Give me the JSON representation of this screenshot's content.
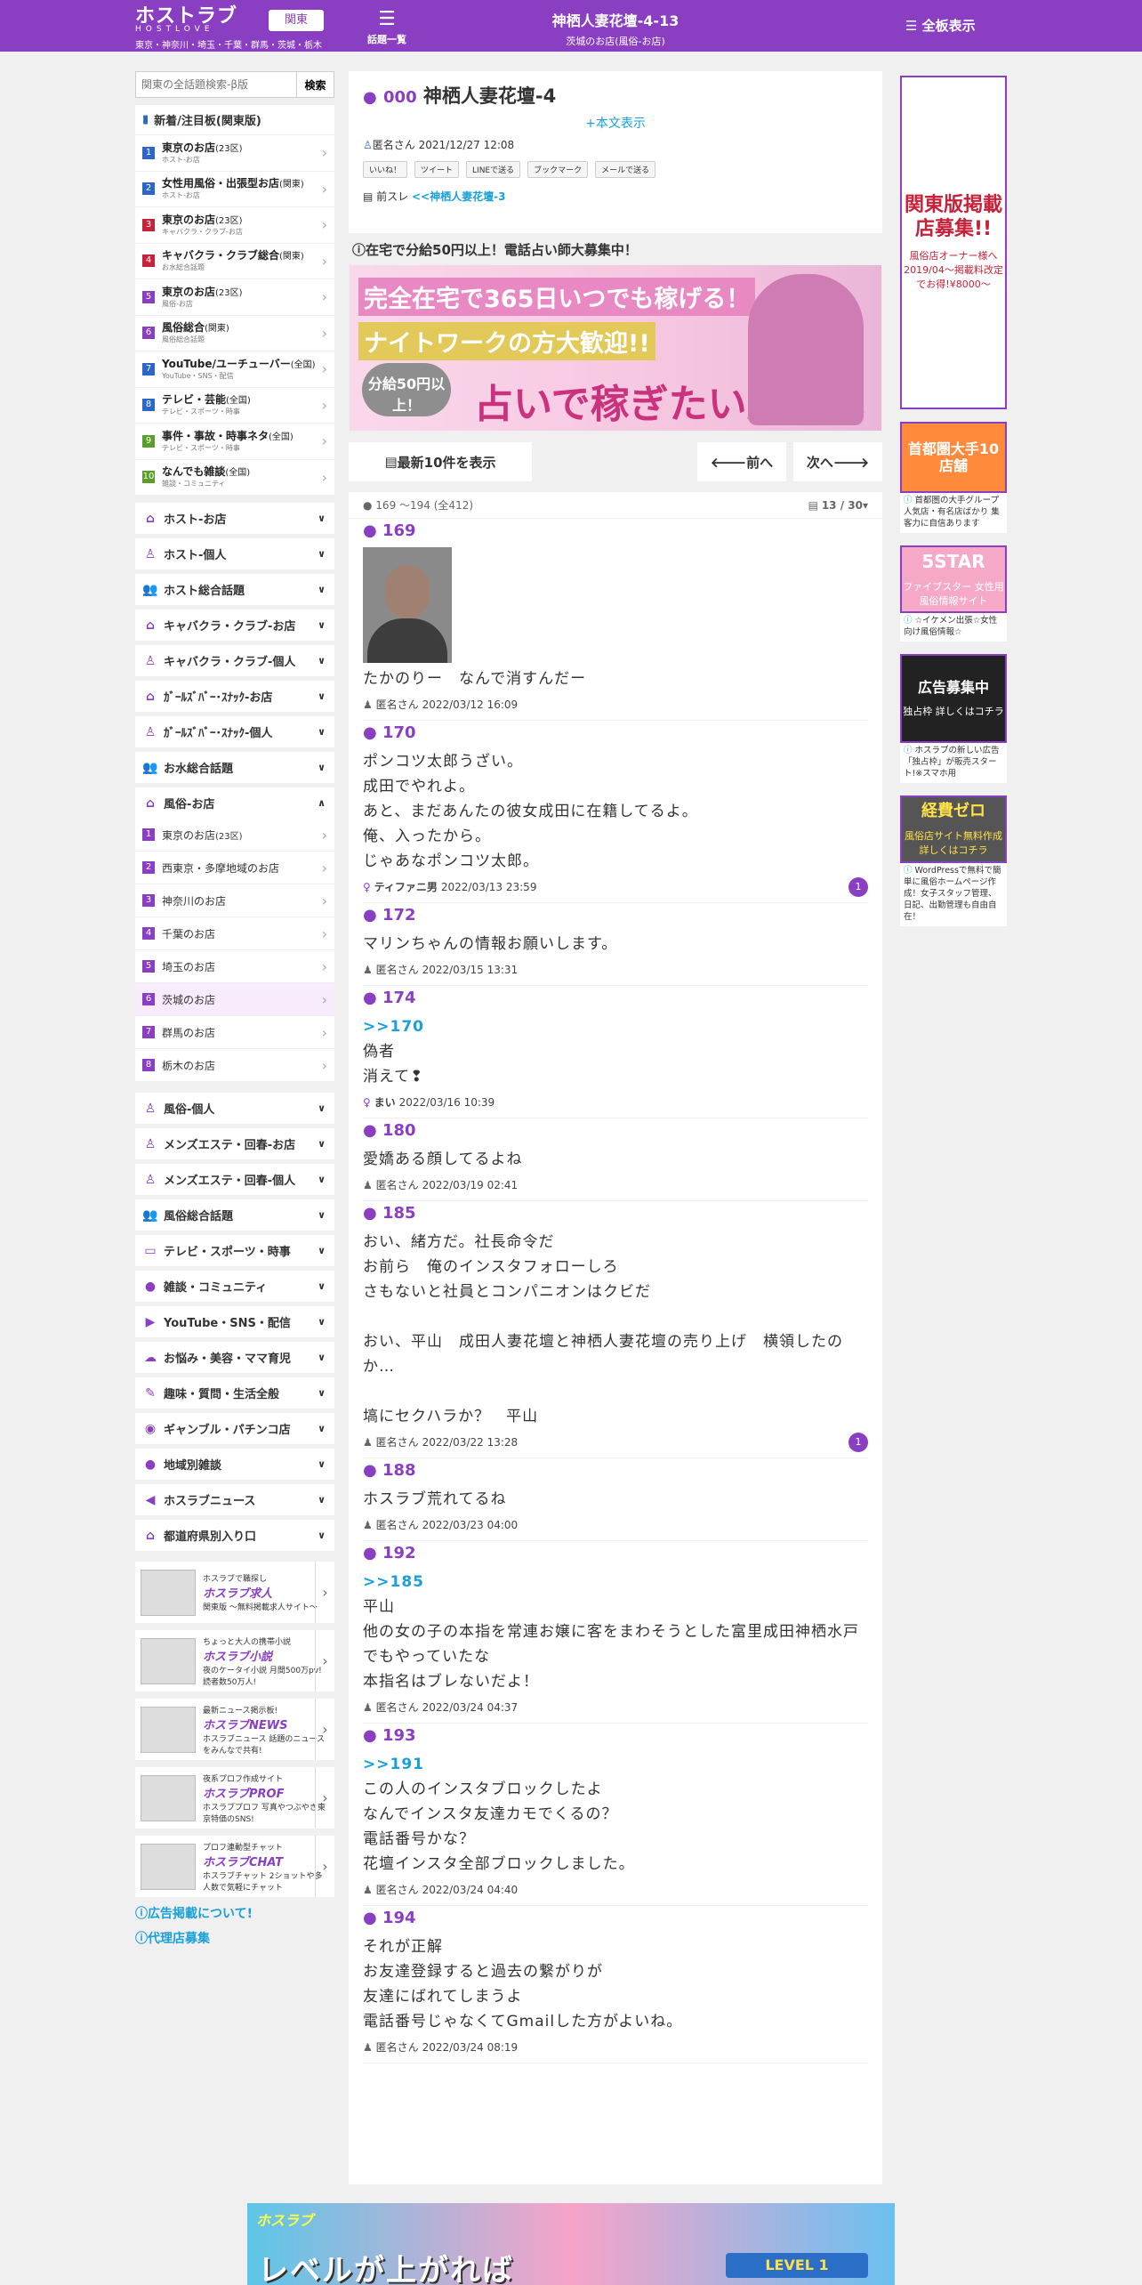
{
  "header": {
    "logo": "ホストラブ",
    "logo_sub": "HOSTLOVE",
    "area": "東京・神奈川・埼玉・千葉・群馬・茨城・栃木",
    "region": "関東",
    "topics": "話題一覧",
    "thread_title": "神栖人妻花壇-4-13",
    "thread_sub": "茨城のお店(風俗-お店)",
    "full": "全板表示"
  },
  "search": {
    "placeholder": "関東の全話題検索-β版",
    "button": "検索"
  },
  "ranking": {
    "title": "新着/注目板(関東版)",
    "items": [
      {
        "n": "1",
        "color": "#2a67c7",
        "main": "東京のお店",
        "tag": "(23区)",
        "sub": "ホスト-お店"
      },
      {
        "n": "2",
        "color": "#2a67c7",
        "main": "女性用風俗・出張型お店",
        "tag": "(関東)",
        "sub": "ホスト-お店"
      },
      {
        "n": "3",
        "color": "#c7223a",
        "main": "東京のお店",
        "tag": "(23区)",
        "sub": "キャバクラ・クラブ-お店"
      },
      {
        "n": "4",
        "color": "#c7223a",
        "main": "キャバクラ・クラブ総合",
        "tag": "(関東)",
        "sub": "お水総合話題"
      },
      {
        "n": "5",
        "color": "#8a3ec2",
        "main": "東京のお店",
        "tag": "(23区)",
        "sub": "風俗-お店"
      },
      {
        "n": "6",
        "color": "#8a3ec2",
        "main": "風俗総合",
        "tag": "(関東)",
        "sub": "風俗総合話題"
      },
      {
        "n": "7",
        "color": "#2a67c7",
        "main": "YouTube/ユーチューバー",
        "tag": "(全国)",
        "sub": "YouTube・SNS・配信"
      },
      {
        "n": "8",
        "color": "#2a67c7",
        "main": "テレビ・芸能",
        "tag": "(全国)",
        "sub": "テレビ・スポーツ・時事"
      },
      {
        "n": "9",
        "color": "#5a9e2a",
        "main": "事件・事故・時事ネタ",
        "tag": "(全国)",
        "sub": "テレビ・スポーツ・時事"
      },
      {
        "n": "10",
        "color": "#5a9e2a",
        "main": "なんでも雑談",
        "tag": "(全国)",
        "sub": "雑談・コミュニティ"
      }
    ]
  },
  "categories_a": [
    {
      "icon": "⌂",
      "label": "ホスト-お店",
      "dir": "∨"
    },
    {
      "icon": "♙",
      "label": "ホスト-個人",
      "dir": "∨"
    },
    {
      "icon": "👥",
      "label": "ホスト総合話題",
      "dir": "∨"
    },
    {
      "icon": "⌂",
      "label": "キャバクラ・クラブ-お店",
      "dir": "∨"
    },
    {
      "icon": "♙",
      "label": "キャバクラ・クラブ-個人",
      "dir": "∨"
    },
    {
      "icon": "⌂",
      "label": "ｶﾞｰﾙｽﾞﾊﾞｰ･ｽﾅｯｸ-お店",
      "dir": "∨"
    },
    {
      "icon": "♙",
      "label": "ｶﾞｰﾙｽﾞﾊﾞｰ･ｽﾅｯｸ-個人",
      "dir": "∨"
    },
    {
      "icon": "👥",
      "label": "お水総合話題",
      "dir": "∨"
    },
    {
      "icon": "⌂",
      "label": "風俗-お店",
      "dir": "∧"
    }
  ],
  "fuzoku_sub": [
    {
      "n": "1",
      "label": "東京のお店",
      "tag": "(23区)"
    },
    {
      "n": "2",
      "label": "西東京・多摩地域のお店",
      "tag": ""
    },
    {
      "n": "3",
      "label": "神奈川のお店",
      "tag": ""
    },
    {
      "n": "4",
      "label": "千葉のお店",
      "tag": ""
    },
    {
      "n": "5",
      "label": "埼玉のお店",
      "tag": ""
    },
    {
      "n": "6",
      "label": "茨城のお店",
      "tag": ""
    },
    {
      "n": "7",
      "label": "群馬のお店",
      "tag": ""
    },
    {
      "n": "8",
      "label": "栃木のお店",
      "tag": ""
    }
  ],
  "categories_b": [
    {
      "icon": "♙",
      "label": "風俗-個人"
    },
    {
      "icon": "♙",
      "label": "メンズエステ・回春-お店"
    },
    {
      "icon": "♙",
      "label": "メンズエステ・回春-個人"
    },
    {
      "icon": "👥",
      "label": "風俗総合話題"
    },
    {
      "icon": "▭",
      "label": "テレビ・スポーツ・時事"
    },
    {
      "icon": "●",
      "label": "雑談・コミュニティ"
    },
    {
      "icon": "▶",
      "label": "YouTube・SNS・配信"
    },
    {
      "icon": "☁",
      "label": "お悩み・美容・ママ育児"
    },
    {
      "icon": "✎",
      "label": "趣味・質問・生活全般"
    },
    {
      "icon": "◉",
      "label": "ギャンブル・パチンコ店"
    },
    {
      "icon": "●",
      "label": "地域別雑談"
    },
    {
      "icon": "◀",
      "label": "ホスラブニュース"
    },
    {
      "icon": "⌂",
      "label": "都道府県別入り口"
    }
  ],
  "promos": [
    {
      "small": "ホスラブで職探し",
      "big": "ホスラブ求人",
      "text": "関東版 〜無料掲載求人サイト〜"
    },
    {
      "small": "ちょっと大人の携帯小説",
      "big": "ホスラブ小説",
      "text": "夜のケータイ小説 月間500万pv! 読者数50万人!"
    },
    {
      "small": "最新ニュース掲示板!",
      "big": "ホスラブNEWS",
      "text": "ホスラブニュース 話題のニュースをみんなで共有!"
    },
    {
      "small": "夜系プロフ作成サイト",
      "big": "ホスラブPROF",
      "text": "ホスラブプロフ 写真やつぶやき東京特価のSNS!"
    },
    {
      "small": "プロフ連動型チャット",
      "big": "ホスラブCHAT",
      "text": "ホスラブチャット 2ショットや多人数で気軽にチャット"
    }
  ],
  "info_links": [
    "広告掲載について!",
    "代理店募集"
  ],
  "thread": {
    "num": "000",
    "title": "神栖人妻花壇-4",
    "show_body": "+本文表示",
    "author": "匿名さん",
    "date": "2021/12/27 12:08",
    "share": [
      "いいね！",
      "ツイート",
      "LINEで送る",
      "ブックマーク",
      "メールで送る"
    ],
    "prev_label": "前スレ",
    "prev_link": "<<神栖人妻花壇-3"
  },
  "ad_notice": "在宅で分給50円以上！電話占い師大募集中！",
  "banner": {
    "l1": "完全在宅で365日いつでも稼げる！",
    "l2": "ナイトワークの方大歓迎!!",
    "l3": "占いで稼ぎたい人大募集！",
    "l4": "分給50円以上！"
  },
  "nav": {
    "latest": "最新10件を表示",
    "prev": "前へ",
    "next": "次へ"
  },
  "range": {
    "text": "169 〜194",
    "total": "(全412)",
    "page": "13 / 30"
  },
  "posts": [
    {
      "num": "169",
      "avatar": true,
      "anchor": "",
      "lines": [
        "たかのりー　なんで消すんだー"
      ],
      "name": "匿名さん",
      "date": "2022/03/12 16:09",
      "count": "",
      "female": false
    },
    {
      "num": "170",
      "anchor": "",
      "lines": [
        "ポンコツ太郎うざい。",
        "成田でやれよ。",
        "あと、まだあんたの彼女成田に在籍してるよ。",
        "俺、入ったから。",
        "じゃあなポンコツ太郎。"
      ],
      "name": "ティファニ男",
      "date": "2022/03/13 23:59",
      "count": "1",
      "female": true
    },
    {
      "num": "172",
      "anchor": "",
      "lines": [
        "マリンちゃんの情報お願いします。"
      ],
      "name": "匿名さん",
      "date": "2022/03/15 13:31",
      "count": "",
      "female": false
    },
    {
      "num": "174",
      "anchor": ">>170",
      "lines": [
        "偽者",
        "消えて❢"
      ],
      "name": "まい",
      "date": "2022/03/16 10:39",
      "count": "",
      "female": true
    },
    {
      "num": "180",
      "anchor": "",
      "lines": [
        "愛嬌ある顔してるよね"
      ],
      "name": "匿名さん",
      "date": "2022/03/19 02:41",
      "count": "",
      "female": false
    },
    {
      "num": "185",
      "anchor": "",
      "lines": [
        "おい、緒方だ。社長命令だ",
        "お前ら　俺のインスタフォローしろ",
        "さもないと社員とコンパニオンはクビだ",
        "",
        "おい、平山　成田人妻花壇と神栖人妻花壇の売り上げ　横領したのか…",
        "",
        "塙にセクハラか？　平山"
      ],
      "name": "匿名さん",
      "date": "2022/03/22 13:28",
      "count": "1",
      "female": false
    },
    {
      "num": "188",
      "anchor": "",
      "lines": [
        "ホスラブ荒れてるね"
      ],
      "name": "匿名さん",
      "date": "2022/03/23 04:00",
      "count": "",
      "female": false
    },
    {
      "num": "192",
      "anchor": ">>185",
      "lines": [
        "平山",
        "他の女の子の本指を常連お嬢に客をまわそうとした富里成田神栖水戸でもやっていたな",
        "本指名はブレないだよ！"
      ],
      "name": "匿名さん",
      "date": "2022/03/24 04:37",
      "count": "",
      "female": false
    },
    {
      "num": "193",
      "anchor": ">>191",
      "lines": [
        "この人のインスタブロックしたよ",
        "なんでインスタ友達カモでくるの？",
        "電話番号かな？",
        "花壇インスタ全部ブロックしました。"
      ],
      "name": "匿名さん",
      "date": "2022/03/24 04:40",
      "count": "",
      "female": false
    },
    {
      "num": "194",
      "anchor": "",
      "lines": [
        "それが正解",
        "お友達登録すると過去の繋がりが",
        "友達にばれてしまうよ",
        "電話番号じゃなくてGmailした方がよいね。"
      ],
      "name": "匿名さん",
      "date": "2022/03/24 08:19",
      "count": "",
      "female": false
    }
  ],
  "right_ads": [
    {
      "title": "関東版掲載店募集!!",
      "text": "風俗店オーナー様へ 2019/04〜掲載料改定でお得!¥8000〜",
      "caption": ""
    },
    {
      "title": "首都圏大手10店舗",
      "text": "",
      "caption": "首都圏の大手グループ 人気店・有名店ばかり 集客力に自信あります"
    },
    {
      "title": "5STAR",
      "text": "ファイブスター 女性用風俗情報サイト",
      "caption": "☆イケメン出張☆女性向け風俗情報☆"
    },
    {
      "title": "広告募集中",
      "text": "独占枠 詳しくはコチラ",
      "caption": "ホスラブの新しい広告「独占枠」が販売スタート!※スマホ用"
    },
    {
      "title": "経費ゼロ",
      "text": "風俗店サイト無料作成 詳しくはコチラ",
      "caption": "WordPressで無料で簡単に風俗ホームページ作成！女子スタッフ管理、日記、出勤管理も自由自在！"
    }
  ],
  "bottom_banner": {
    "logo": "ホスラブ",
    "text": "レベルが上がれば",
    "level": "LEVEL 1"
  }
}
